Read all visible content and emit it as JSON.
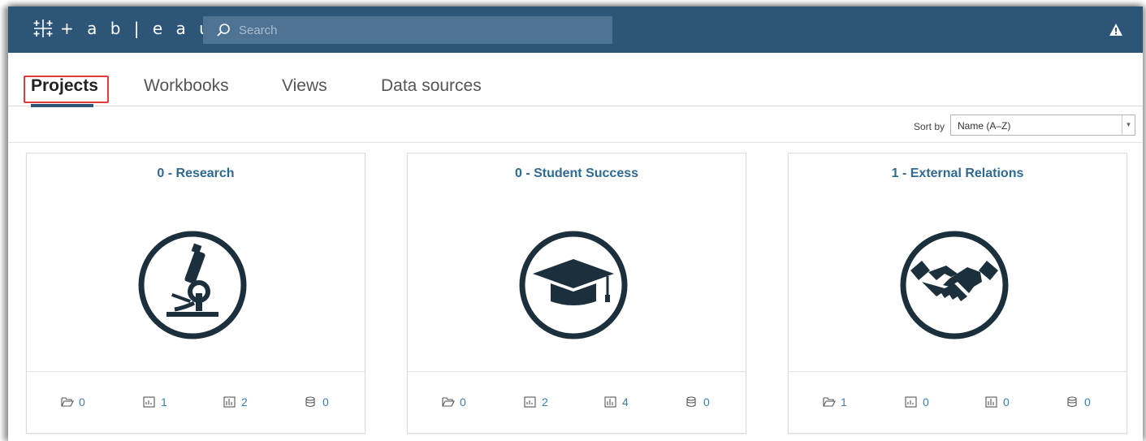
{
  "brand": {
    "logo_text": "+ a b | e a u",
    "icon": "tableau-logo-icon"
  },
  "search": {
    "placeholder": "Search",
    "icon": "search-icon"
  },
  "header_icons": {
    "alert": "alert-icon"
  },
  "tabs": [
    {
      "label": "Projects",
      "active": true
    },
    {
      "label": "Workbooks",
      "active": false
    },
    {
      "label": "Views",
      "active": false
    },
    {
      "label": "Data sources",
      "active": false
    }
  ],
  "sort": {
    "label": "Sort by",
    "selected": "Name (A–Z)"
  },
  "projects": [
    {
      "title": "0 - Research",
      "icon": "microscope-icon",
      "counts": {
        "projects": "0",
        "workbooks": "1",
        "views": "2",
        "datasources": "0"
      }
    },
    {
      "title": "0 - Student Success",
      "icon": "graduation-cap-icon",
      "counts": {
        "projects": "0",
        "workbooks": "2",
        "views": "4",
        "datasources": "0"
      }
    },
    {
      "title": "1 - External Relations",
      "icon": "handshake-icon",
      "counts": {
        "projects": "1",
        "workbooks": "0",
        "views": "0",
        "datasources": "0"
      }
    }
  ],
  "colors": {
    "nav": "#2d5577",
    "accent": "#2f6a92",
    "link": "#3a7fb0",
    "highlight": "#e03a3a",
    "icon": "#1b2f3d"
  }
}
